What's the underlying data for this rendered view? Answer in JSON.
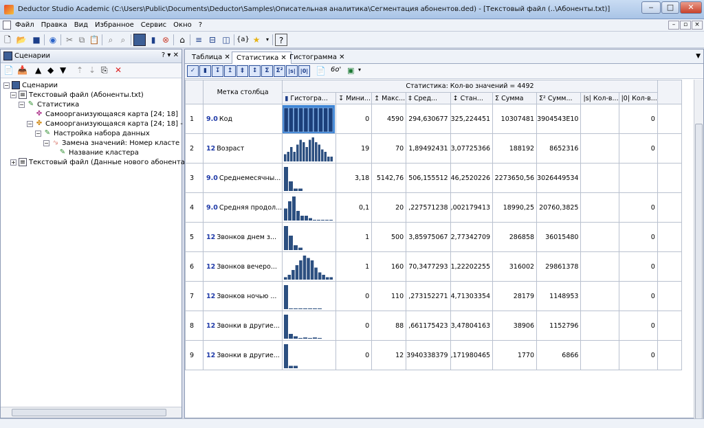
{
  "window": {
    "title": "Deductor Studio Academic (C:\\Users\\Public\\Documents\\Deductor\\Samples\\Описательная аналитика\\Сегментация абонентов.ded) - [Текстовый файл (..\\Абоненты.txt)]"
  },
  "menu": [
    "Файл",
    "Правка",
    "Вид",
    "Избранное",
    "Сервис",
    "Окно",
    "?"
  ],
  "left_panel": {
    "title": "Сценарии",
    "controls": "? ▾ ✕",
    "tree": [
      {
        "label": "Сценарии",
        "icon": "scenarios-icon",
        "level": 0
      },
      {
        "label": "Текстовый файл (Абоненты.txt)",
        "icon": "text-file-icon",
        "level": 1
      },
      {
        "label": "Статистика",
        "icon": "statistics-icon",
        "level": 2
      },
      {
        "label": "Самоорганизующаяся карта [24; 18]",
        "icon": "som-icon",
        "level": 3
      },
      {
        "label": "Самоорганизующаяся карта [24; 18] -",
        "icon": "som-icon",
        "level": 3
      },
      {
        "label": "Настройка набора данных",
        "icon": "dataset-setup-icon",
        "level": 4
      },
      {
        "label": "Замена значений: Номер класте",
        "icon": "replace-values-icon",
        "level": 5
      },
      {
        "label": "Название кластера",
        "icon": "rename-icon",
        "level": 6
      },
      {
        "label": "Текстовый файл (Данные нового абонента",
        "icon": "text-file-icon",
        "level": 1
      }
    ]
  },
  "tabs": [
    "Таблица",
    "Статистика",
    "Гистограмма"
  ],
  "stats": {
    "group_header": "Статистика: Кол-во значений = 4492",
    "label_header": "Метка столбца",
    "columns": [
      "Гистогра...",
      "Мини...",
      "Макс...",
      "Сред...",
      "Стан...",
      "Сумма",
      "Сумм...",
      "Кол-в...",
      "Кол-в..."
    ],
    "rows": [
      {
        "n": "1",
        "type": "9.0",
        "name": "Код",
        "min": "0",
        "max": "4590",
        "mean": "294,630677",
        "std": "325,224451",
        "sum": "10307481",
        "sum2": "3904543E10",
        "cnt": "0",
        "hist": [
          10,
          10,
          10,
          10,
          10,
          10,
          10,
          10,
          10,
          10
        ],
        "selected": true
      },
      {
        "n": "2",
        "type": "12",
        "name": "Возраст",
        "min": "19",
        "max": "70",
        "mean": "1,89492431",
        "std": "3,07725366",
        "sum": "188192",
        "sum2": "8652316",
        "cnt": "0",
        "hist": [
          3,
          4,
          6,
          4,
          7,
          9,
          8,
          6,
          9,
          10,
          8,
          7,
          5,
          4,
          2,
          2
        ]
      },
      {
        "n": "3",
        "type": "9.0",
        "name": "Среднемесячны...",
        "min": "3,18",
        "max": "5142,76",
        "mean": "506,155512",
        "std": "46,2520226",
        "sum": "2273650,56",
        "sum2": "3026449534",
        "cnt": "",
        "hist": [
          10,
          4,
          1,
          1
        ]
      },
      {
        "n": "4",
        "type": "9.0",
        "name": "Средняя продол...",
        "min": "0,1",
        "max": "20",
        "mean": ",227571238",
        "std": ",002179413",
        "sum": "18990,25",
        "sum2": "20760,3825",
        "cnt": "0",
        "hist": [
          5,
          8,
          10,
          4,
          2,
          2,
          1,
          0.3,
          0.3,
          0.3,
          0.3,
          0.3
        ]
      },
      {
        "n": "5",
        "type": "12",
        "name": "Звонков днем з...",
        "min": "1",
        "max": "500",
        "mean": "3,85975067",
        "std": "2,77342709",
        "sum": "286858",
        "sum2": "36015480",
        "cnt": "0",
        "hist": [
          10,
          6,
          2,
          1
        ]
      },
      {
        "n": "6",
        "type": "12",
        "name": "Звонков вечеро...",
        "min": "1",
        "max": "160",
        "mean": "70,3477293",
        "std": "1,22202255",
        "sum": "316002",
        "sum2": "29861378",
        "cnt": "0",
        "hist": [
          1,
          2,
          4,
          6,
          8,
          10,
          9,
          8,
          5,
          3,
          2,
          1,
          1
        ]
      },
      {
        "n": "7",
        "type": "12",
        "name": "Звонков ночью ...",
        "min": "0",
        "max": "110",
        "mean": ",273152271",
        "std": "4,71303354",
        "sum": "28179",
        "sum2": "1148953",
        "cnt": "0",
        "hist": [
          10,
          0.3,
          0.3,
          0.3,
          0.3,
          0.3,
          0.3,
          0.3
        ]
      },
      {
        "n": "8",
        "type": "12",
        "name": "Звонки в другие...",
        "min": "0",
        "max": "88",
        "mean": ",661175423",
        "std": "3,47804163",
        "sum": "38906",
        "sum2": "1152796",
        "cnt": "0",
        "hist": [
          10,
          2,
          1,
          0.3,
          0.5,
          0.3,
          0.5,
          0.3
        ]
      },
      {
        "n": "9",
        "type": "12",
        "name": "Звонки в другие...",
        "min": "0",
        "max": "12",
        "mean": "3940338379",
        "std": ",171980465",
        "sum": "1770",
        "sum2": "6866",
        "cnt": "0",
        "hist": [
          10,
          1,
          1
        ]
      }
    ]
  }
}
